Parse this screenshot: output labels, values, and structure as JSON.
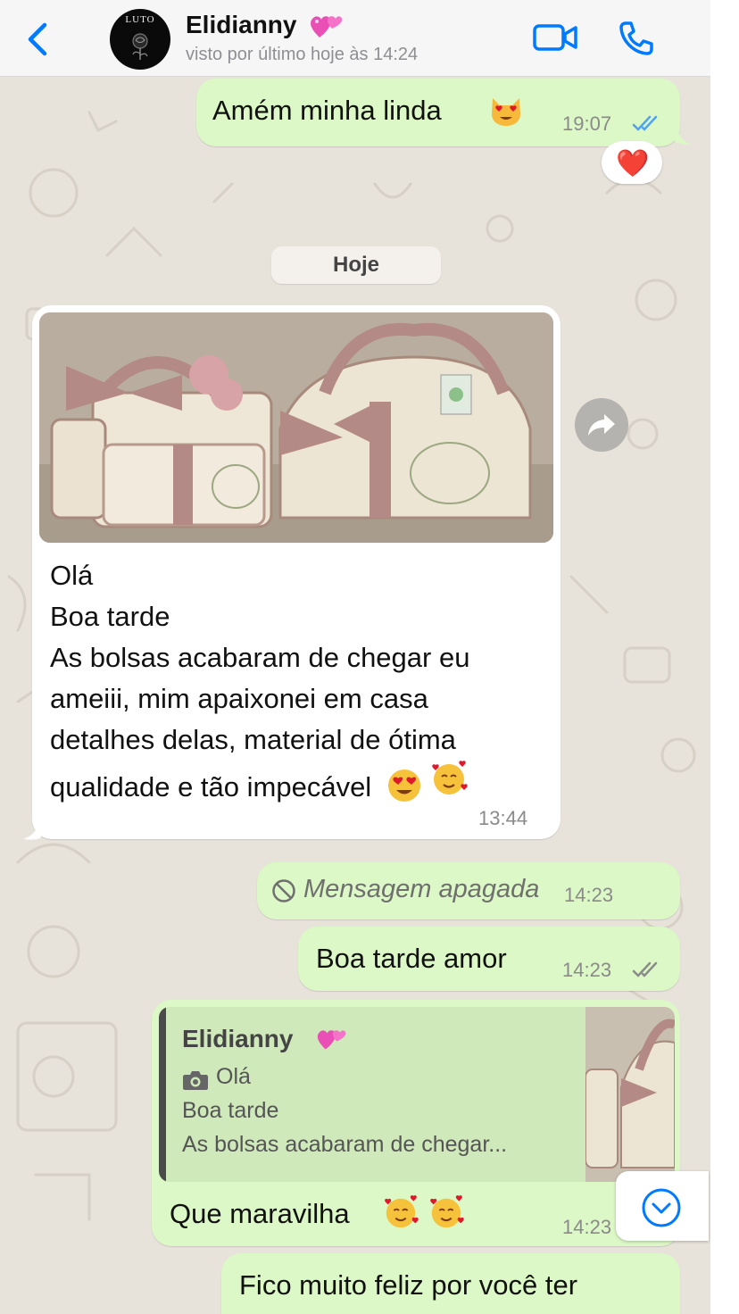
{
  "header": {
    "contact_name": "Elidianny",
    "last_seen": "visto por último hoje às 14:24",
    "avatar_text": "LUTO"
  },
  "messages": {
    "m1": {
      "text": "Amém minha linda",
      "time": "19:07",
      "status": "read",
      "reaction": "❤️"
    },
    "date_separator": "Hoje",
    "m2": {
      "lines": [
        "Olá",
        "Boa tarde",
        "As bolsas acabaram de chegar eu",
        "ameiii, mim apaixonei em casa",
        "detalhes delas, material de ótima",
        "qualidade e tão impecável"
      ],
      "time": "13:44"
    },
    "m3": {
      "text": "Mensagem apagada",
      "time": "14:23"
    },
    "m4": {
      "text": "Boa tarde amor",
      "time": "14:23",
      "status": "delivered"
    },
    "m5": {
      "quote": {
        "author": "Elidianny",
        "line1": "Olá",
        "line2": "Boa tarde",
        "line3": "As bolsas acabaram de chegar..."
      },
      "text": "Que maravilha",
      "time": "14:23"
    },
    "m6": {
      "text": "Fico muito feliz por você ter"
    }
  },
  "colors": {
    "accent": "#007aff",
    "outgoing_bubble": "#dcf8c6",
    "incoming_bubble": "#ffffff",
    "chat_background": "#e7e2da",
    "read_check": "#4fa3f7"
  },
  "icons": [
    "back-chevron-icon",
    "video-call-icon",
    "phone-call-icon",
    "forward-icon",
    "deleted-icon",
    "camera-icon",
    "scroll-down-icon",
    "hearts-emoji",
    "heart-eyes-cat-emoji",
    "heart-eyes-emoji",
    "smiling-hearts-emoji"
  ]
}
